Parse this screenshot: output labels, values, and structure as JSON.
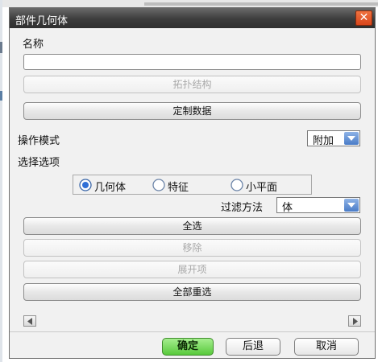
{
  "window": {
    "title": "部件几何体"
  },
  "name_field": {
    "label": "名称",
    "value": ""
  },
  "buttons": {
    "topology": "拓扑结构",
    "custom_data": "定制数据",
    "select_all": "全选",
    "remove": "移除",
    "expand": "展开项",
    "reselect_all": "全部重选"
  },
  "operation_mode": {
    "label": "操作模式",
    "value": "附加"
  },
  "select_options": {
    "label": "选择选项",
    "radios": [
      {
        "label": "几何体",
        "selected": true
      },
      {
        "label": "特征",
        "selected": false
      },
      {
        "label": "小平面",
        "selected": false
      }
    ]
  },
  "filter": {
    "label": "过滤方法",
    "value": "体"
  },
  "footer": {
    "ok": "确定",
    "back": "后退",
    "cancel": "取消"
  },
  "colors": {
    "accent": "#4a7cc7",
    "ok": "#58c93c",
    "close": "#e0521f"
  }
}
